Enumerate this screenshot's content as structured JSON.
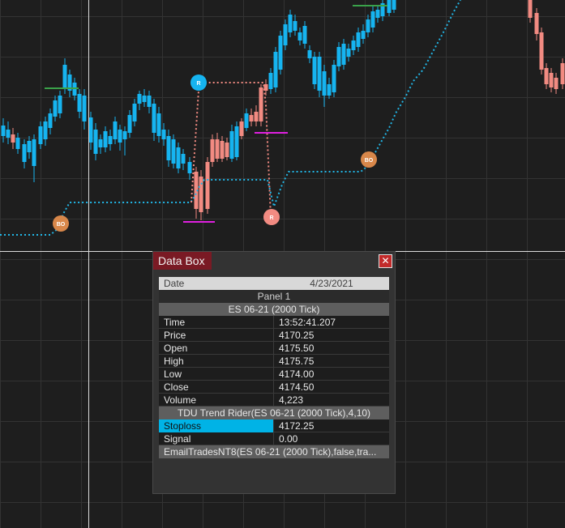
{
  "colors": {
    "background": "#1e1e1e",
    "up_candle": "#16b4f0",
    "down_candle": "#f28b82",
    "trail_stop": "#22b6e6",
    "trade_line": "#f28b82",
    "breakout": "#d8874a",
    "level_magenta": "#e020e0",
    "level_green": "#3aa24a",
    "crosshair": "#dcdcdc"
  },
  "markers": {
    "bo_left": "BO",
    "bo_right": "BO",
    "r_top": "R",
    "r_bottom": "R"
  },
  "databox": {
    "title": "Data Box",
    "close_icon": "✕",
    "date_label": "Date",
    "date_value": "4/23/2021",
    "panel": "Panel 1",
    "instrument": "ES 06-21 (2000 Tick)",
    "rows": [
      {
        "label": "Time",
        "value": "13:52:41.207"
      },
      {
        "label": "Price",
        "value": "4170.25"
      },
      {
        "label": "Open",
        "value": "4175.50"
      },
      {
        "label": "High",
        "value": "4175.75"
      },
      {
        "label": "Low",
        "value": "4174.00"
      },
      {
        "label": "Close",
        "value": "4174.50"
      },
      {
        "label": "Volume",
        "value": "4,223"
      }
    ],
    "indicator": "TDU Trend Rider(ES 06-21 (2000 Tick),4,10)",
    "indicator_rows": [
      {
        "label": "Stoploss",
        "value": "4172.25"
      },
      {
        "label": "Signal",
        "value": "0.00"
      }
    ],
    "strategy": "EmailTradesNT8(ES 06-21 (2000 Tick),false,tra..."
  }
}
